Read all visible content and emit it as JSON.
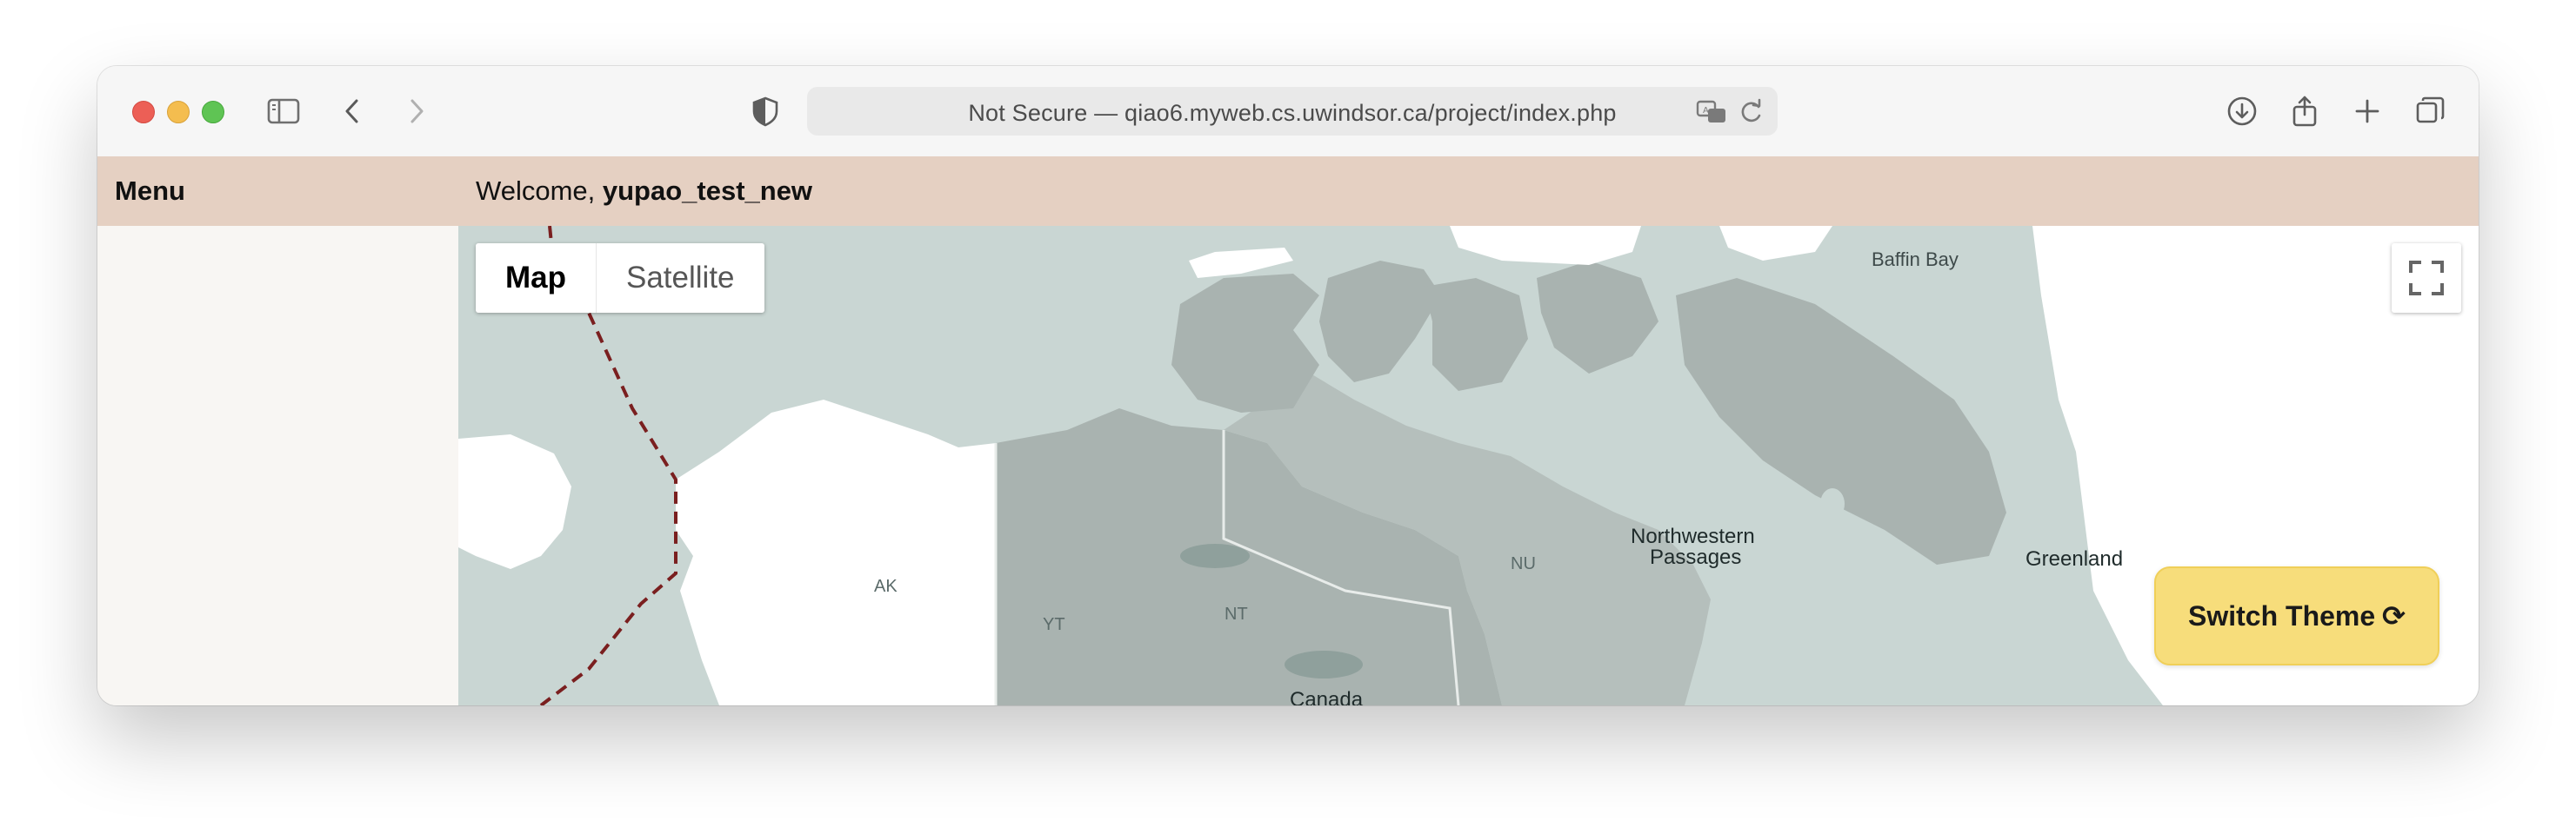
{
  "browser": {
    "address": "Not Secure — qiao6.myweb.cs.uwindsor.ca/project/index.php"
  },
  "header": {
    "menu_label": "Menu",
    "welcome_prefix": "Welcome, ",
    "username": "yupao_test_new"
  },
  "map": {
    "type_options": [
      "Map",
      "Satellite"
    ],
    "selected_type": "Map",
    "labels": {
      "baffin_bay": "Baffin Bay",
      "northwestern_line1": "Northwestern",
      "northwestern_line2": "Passages",
      "greenland": "Greenland",
      "ak": "AK",
      "yt": "YT",
      "nt": "NT",
      "nu": "NU",
      "canada": "Canada"
    }
  },
  "switch_theme": {
    "label": "Switch Theme",
    "icon": "refresh-icon"
  },
  "colors": {
    "header_bg": "#e5d0c2",
    "sidebar_bg": "#f8f6f3",
    "water": "#c9d6d3",
    "button_bg": "#f7dd7b"
  }
}
